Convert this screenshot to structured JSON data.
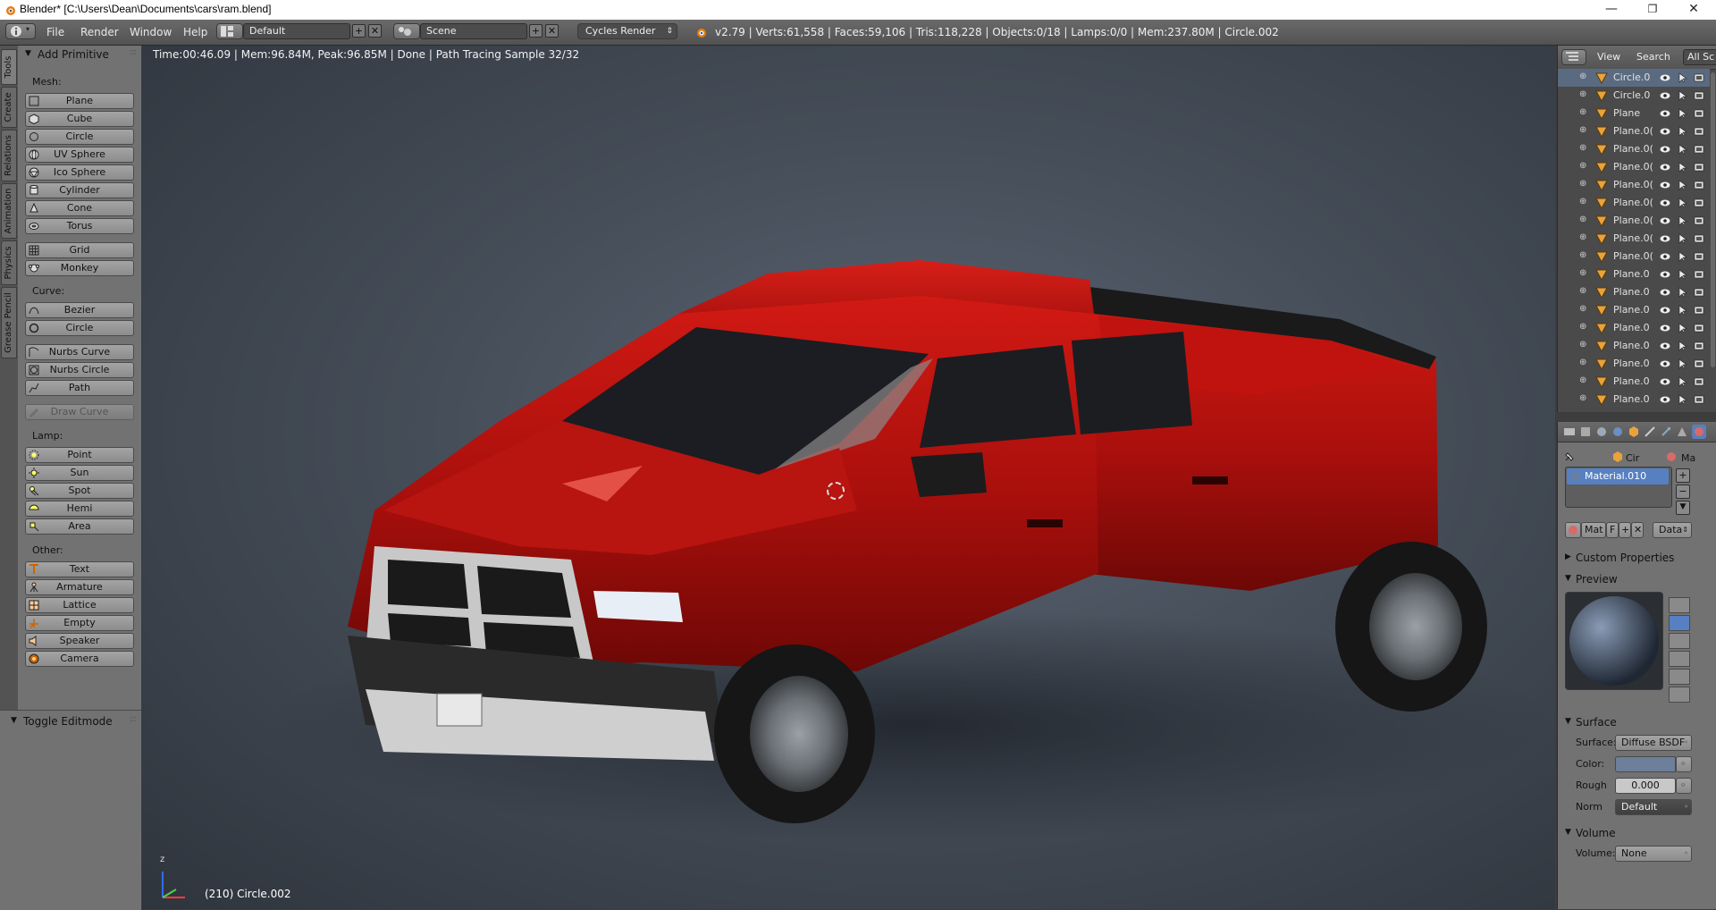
{
  "window": {
    "title": "Blender* [C:\\Users\\Dean\\Documents\\cars\\ram.blend]",
    "minimize": "—",
    "maximize": "❐",
    "close": "✕"
  },
  "header": {
    "menus": [
      "File",
      "Render",
      "Window",
      "Help"
    ],
    "screen_layout": "Default",
    "scene": "Scene",
    "render_engine": "Cycles Render",
    "stats": "v2.79 | Verts:61,558 | Faces:59,106 | Tris:118,228 | Objects:0/18 | Lamps:0/0 | Mem:237.80M | Circle.002"
  },
  "left_tabs": [
    "Tools",
    "Create",
    "Relations",
    "Animation",
    "Physics",
    "Grease Pencil"
  ],
  "toolshelf": {
    "panel_title": "Add Primitive",
    "mesh_label": "Mesh:",
    "mesh": [
      "Plane",
      "Cube",
      "Circle",
      "UV Sphere",
      "Ico Sphere",
      "Cylinder",
      "Cone",
      "Torus"
    ],
    "mesh2": [
      "Grid",
      "Monkey"
    ],
    "curve_label": "Curve:",
    "curve": [
      "Bezier",
      "Circle"
    ],
    "curve2": [
      "Nurbs Curve",
      "Nurbs Circle",
      "Path"
    ],
    "draw_curve": "Draw Curve",
    "lamp_label": "Lamp:",
    "lamp": [
      "Point",
      "Sun",
      "Spot",
      "Hemi",
      "Area"
    ],
    "other_label": "Other:",
    "other": [
      "Text",
      "Armature",
      "Lattice",
      "Empty",
      "Speaker",
      "Camera"
    ],
    "toggle_editmode": "Toggle Editmode"
  },
  "viewport": {
    "render_info": "Time:00:46.09 | Mem:96.84M, Peak:96.85M | Done | Path Tracing Sample 32/32",
    "active_object": "(210) Circle.002",
    "axis_z": "z",
    "colors": {
      "truck_body": "#b01010",
      "background": "#4a525d"
    }
  },
  "outliner": {
    "view": "View",
    "search": "Search",
    "all_scenes": "All Sc",
    "items": [
      "Circle.0",
      "Circle.0",
      "Plane",
      "Plane.0(",
      "Plane.0(",
      "Plane.0(",
      "Plane.0(",
      "Plane.0(",
      "Plane.0(",
      "Plane.0(",
      "Plane.0(",
      "Plane.0",
      "Plane.0",
      "Plane.0",
      "Plane.0",
      "Plane.0",
      "Plane.0",
      "Plane.0",
      "Plane.0"
    ]
  },
  "properties": {
    "breadcrumb_object": "Cir",
    "breadcrumb_material": "Ma",
    "material_slot": "Material.010",
    "mat_field": "Mat",
    "f_label": "F",
    "data_dropdown": "Data",
    "custom_properties": "Custom Properties",
    "preview": "Preview",
    "surface_panel": "Surface",
    "surface_label": "Surface:",
    "surface_value": "Diffuse BSDF",
    "color_label": "Color:",
    "color_value": "#6d7f9a",
    "rough_label": "Rough",
    "rough_value": "0.000",
    "norm_label": "Norm",
    "norm_value": "Default",
    "volume_panel": "Volume",
    "volume_label": "Volume:",
    "volume_value": "None"
  }
}
